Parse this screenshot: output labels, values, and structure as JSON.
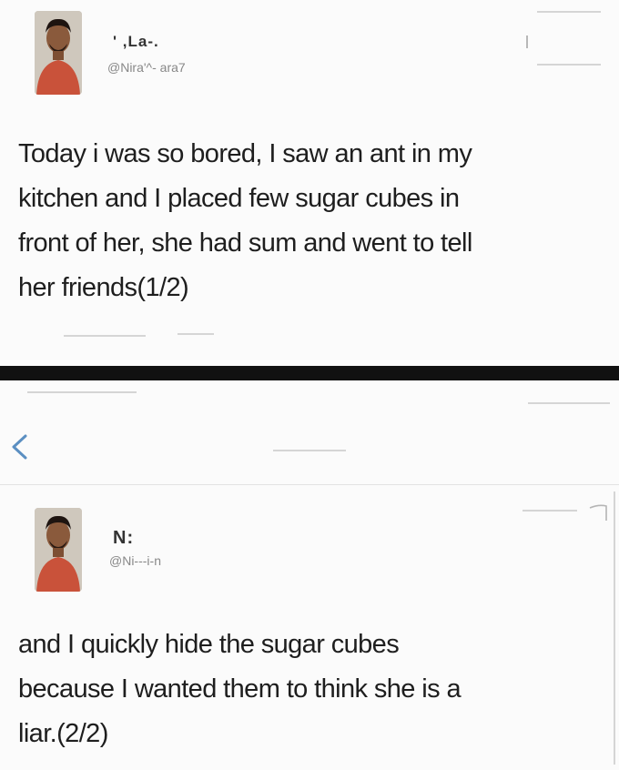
{
  "tweet1": {
    "name": "' ,La-.",
    "handle": "@Nira'^- ara7",
    "text_lines": [
      "Today i was so bored, I saw an ant in my",
      "kitchen and I placed few sugar cubes in",
      "front of her, she had sum and went to tell",
      "her friends(1/2)"
    ]
  },
  "tweet2": {
    "name": "N:",
    "handle": "@Ni---i-n",
    "text_lines": [
      "and I quickly hide the sugar cubes",
      "because I wanted them to think she is a",
      "liar.(2/2)"
    ]
  },
  "icons": {
    "back": "chevron-left-icon",
    "menu": "chevron-down-icon",
    "caret": "caret-icon"
  },
  "colors": {
    "accent_blue": "#5b8fc2",
    "divider": "#111111"
  }
}
